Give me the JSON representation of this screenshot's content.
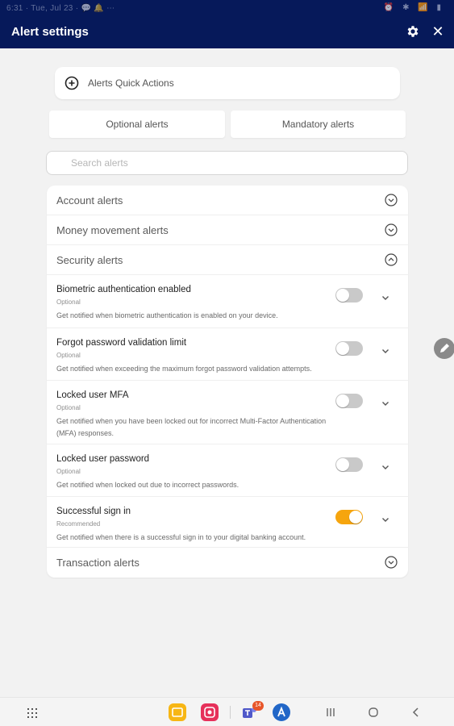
{
  "app": {
    "title": "Alert settings",
    "icons": {
      "settings": "gear-icon",
      "close": "close-icon"
    }
  },
  "status_bar": {
    "left_text": "6:31 · Tue, Jul 23 · 💬 🔔 ⋯",
    "right_text": "⏰ ✱ 📶 ▮"
  },
  "quick_actions": {
    "label": "Alerts Quick Actions",
    "icon": "plus-circle-icon"
  },
  "tabs": [
    {
      "label": "Optional alerts"
    },
    {
      "label": "Mandatory alerts"
    }
  ],
  "search": {
    "placeholder": "Search alerts",
    "value": ""
  },
  "categories": {
    "account": {
      "label": "Account alerts",
      "expanded": false
    },
    "money": {
      "label": "Money movement alerts",
      "expanded": false
    },
    "security": {
      "label": "Security alerts",
      "expanded": true
    },
    "transaction": {
      "label": "Transaction alerts",
      "expanded": false
    }
  },
  "security_alerts": [
    {
      "name": "Biometric authentication enabled",
      "tag": "Optional",
      "description": "Get notified when biometric authentication is enabled on your device.",
      "enabled": false
    },
    {
      "name": "Forgot password validation limit",
      "tag": "Optional",
      "description": "Get notified when exceeding the maximum forgot password validation attempts.",
      "enabled": false
    },
    {
      "name": "Locked user MFA",
      "tag": "Optional",
      "description": "Get notified when you have been locked out for incorrect Multi-Factor Authentication (MFA) responses.",
      "enabled": false
    },
    {
      "name": "Locked user password",
      "tag": "Optional",
      "description": "Get notified when locked out due to incorrect passwords.",
      "enabled": false
    },
    {
      "name": "Successful sign in",
      "tag": "Recommended",
      "description": "Get notified when there is a successful sign in to your digital banking account.",
      "enabled": true
    }
  ],
  "colors": {
    "header": "#06195a",
    "toggle_on": "#f6a50e",
    "toggle_off": "#c9c9c9"
  },
  "nav_bar": {
    "teams_badge": "14"
  }
}
